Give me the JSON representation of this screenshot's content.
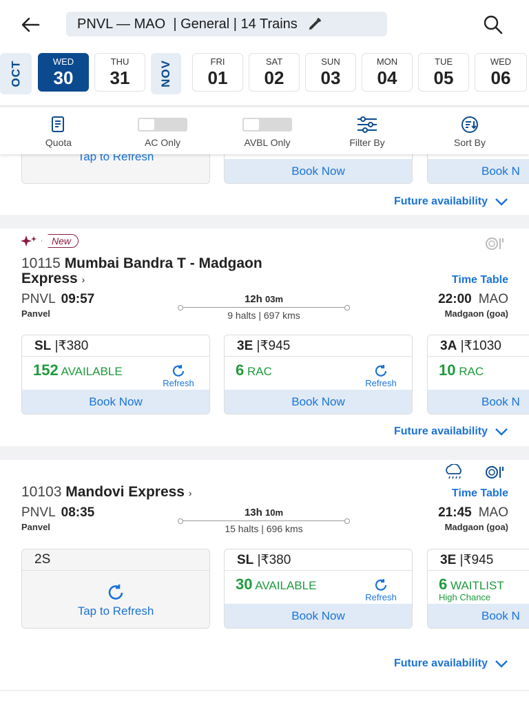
{
  "header": {
    "route": "PNVL — MAO",
    "quota": "| General | 14 Trains"
  },
  "dates": {
    "month_oct": "OCT",
    "month_nov": "NOV",
    "days": [
      {
        "dow": "WED",
        "num": "30"
      },
      {
        "dow": "THU",
        "num": "31"
      },
      {
        "dow": "FRI",
        "num": "01"
      },
      {
        "dow": "SAT",
        "num": "02"
      },
      {
        "dow": "SUN",
        "num": "03"
      },
      {
        "dow": "MON",
        "num": "04"
      },
      {
        "dow": "TUE",
        "num": "05"
      },
      {
        "dow": "WED",
        "num": "06"
      }
    ]
  },
  "filters": {
    "quota": "Quota",
    "ac_only": "AC Only",
    "avbl_only": "AVBL Only",
    "filter_by": "Filter By",
    "sort_by": "Sort By"
  },
  "card0": {
    "tap_refresh": "Tap to Refresh",
    "book_now": "Book Now",
    "book_now_partial": "Book N",
    "future": "Future availability"
  },
  "train1": {
    "badge": "New",
    "number": "10115",
    "name_line1": "Mumbai Bandra T - Madgaon",
    "name_line2": "Express",
    "time_table": "Time Table",
    "from_code": "PNVL",
    "from_time": "09:57",
    "from_name": "Panvel",
    "dur_h": "12h",
    "dur_m": "03m",
    "halts": "9 halts | 697 kms",
    "to_time": "22:00",
    "to_code": "MAO",
    "to_name": "Madgaon (goa)",
    "classes": [
      {
        "cls": "SL",
        "fare": "|₹380",
        "num": "152",
        "status": "AVAILABLE",
        "refresh": "Refresh",
        "book": "Book Now"
      },
      {
        "cls": "3E",
        "fare": "|₹945",
        "num": "6",
        "status": "RAC",
        "refresh": "Refresh",
        "book": "Book Now"
      },
      {
        "cls": "3A",
        "fare": "|₹1030",
        "num": "10",
        "status": "RAC",
        "book": "Book N"
      }
    ],
    "future": "Future availability"
  },
  "train2": {
    "number": "10103",
    "name": "Mandovi Express",
    "time_table": "Time Table",
    "from_code": "PNVL",
    "from_time": "08:35",
    "from_name": "Panvel",
    "dur_h": "13h",
    "dur_m": "10m",
    "halts": "15 halts | 696 kms",
    "to_time": "21:45",
    "to_code": "MAO",
    "to_name": "Madgaon (goa)",
    "classes": [
      {
        "cls": "2S",
        "tap": "Tap to Refresh"
      },
      {
        "cls": "SL",
        "fare": "|₹380",
        "num": "30",
        "status": "AVAILABLE",
        "refresh": "Refresh",
        "book": "Book Now"
      },
      {
        "cls": "3E",
        "fare": "|₹945",
        "num": "6",
        "status": "WAITLIST",
        "sub": "High Chance",
        "book": "Book N"
      }
    ],
    "future": "Future availability"
  },
  "colors": {
    "primary": "#0b4a8f",
    "link": "#1a73d6",
    "available": "#1e9a3c",
    "new_badge": "#8a1a3f"
  }
}
